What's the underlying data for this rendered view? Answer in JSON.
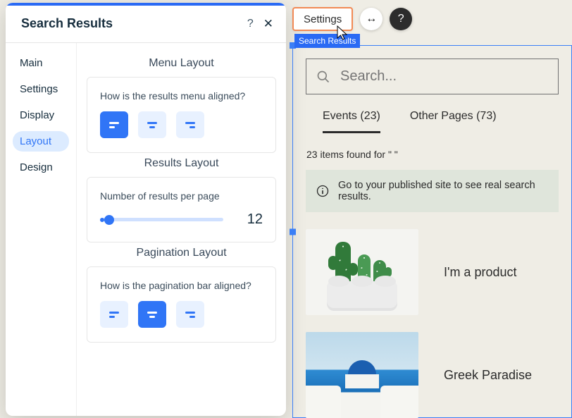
{
  "panel": {
    "title": "Search Results",
    "nav": {
      "main": "Main",
      "settings": "Settings",
      "display": "Display",
      "layout": "Layout",
      "design": "Design"
    },
    "sections": {
      "menu_layout": {
        "title": "Menu Layout",
        "question": "How is the results menu aligned?"
      },
      "results_layout": {
        "title": "Results Layout",
        "label": "Number of results per page",
        "value": "12"
      },
      "pagination_layout": {
        "title": "Pagination Layout",
        "question": "How is the pagination bar aligned?"
      }
    }
  },
  "canvas": {
    "toolbar": {
      "settings_label": "Settings"
    },
    "selection_tag": "Search Results",
    "search": {
      "placeholder": "Search..."
    },
    "tabs": {
      "events": "Events (23)",
      "other": "Other Pages (73)"
    },
    "found_line": "23 items found for \" \"",
    "notice": "Go to your published site to see real search results.",
    "results": [
      {
        "title": "I'm a product"
      },
      {
        "title": "Greek Paradise"
      }
    ]
  }
}
